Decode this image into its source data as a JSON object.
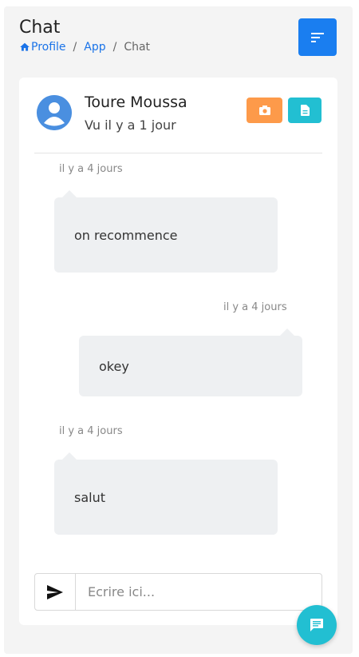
{
  "header": {
    "title": "Chat",
    "breadcrumb": {
      "home_label": "Profile",
      "items": [
        "App",
        "Chat"
      ],
      "separator": "/"
    },
    "menu_icon": "sort-icon"
  },
  "chat": {
    "contact": {
      "name": "Toure Moussa",
      "status": "Vu il y a 1 jour",
      "avatar_icon": "user-avatar-icon"
    },
    "actions": {
      "photo_icon": "camera-icon",
      "photo_color": "#fd9a4a",
      "document_icon": "document-icon",
      "document_color": "#22bfd2"
    },
    "messages": [
      {
        "side": "left",
        "time": "il y a 4 jours",
        "text": "on recommence"
      },
      {
        "side": "right",
        "time": "il y a 4 jours",
        "text": "okey"
      },
      {
        "side": "left",
        "time": "il y a 4 jours",
        "text": "salut"
      }
    ],
    "composer": {
      "send_icon": "send-icon",
      "placeholder": "Ecrire ici..."
    }
  },
  "fab": {
    "icon": "chat-icon",
    "color": "#22bfd2"
  },
  "colors": {
    "primary": "#1a7ef0",
    "link": "#1a73e8",
    "bubble": "#eef0f2",
    "background": "#f4f4f4"
  }
}
